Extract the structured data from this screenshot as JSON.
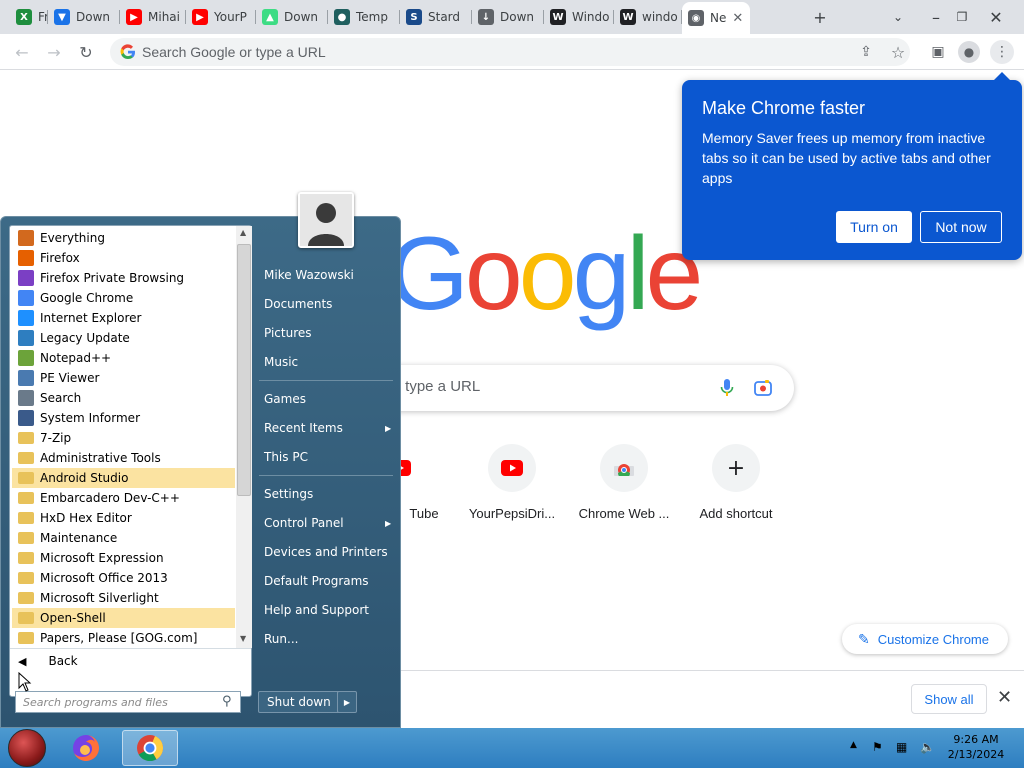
{
  "browser": {
    "tabs": [
      {
        "label": "Free S",
        "fav_color": "#1e8e3e",
        "fav_glyph": "X"
      },
      {
        "label": "Down",
        "fav_color": "#1a73e8",
        "fav_glyph": "▼"
      },
      {
        "label": "Mihai",
        "fav_color": "#ff0000",
        "fav_glyph": "▶"
      },
      {
        "label": "YourP",
        "fav_color": "#ff0000",
        "fav_glyph": "▶"
      },
      {
        "label": "Down",
        "fav_color": "#3ddc84",
        "fav_glyph": "▲"
      },
      {
        "label": "Temp",
        "fav_color": "#1f5f5f",
        "fav_glyph": "●"
      },
      {
        "label": "Stard",
        "fav_color": "#1a4a8a",
        "fav_glyph": "S"
      },
      {
        "label": "Down",
        "fav_color": "#5f6368",
        "fav_glyph": "↓"
      },
      {
        "label": "Windo",
        "fav_color": "#202124",
        "fav_glyph": "W"
      },
      {
        "label": "windo",
        "fav_color": "#202124",
        "fav_glyph": "W"
      },
      {
        "label": "Ne",
        "fav_color": "#5f6368",
        "fav_glyph": "◉"
      }
    ],
    "new_tab_glyph": "+",
    "omnibox_placeholder": "Search Google or type a URL"
  },
  "ntp": {
    "logo_letters": [
      {
        "ch": "G",
        "color": "#4285f4"
      },
      {
        "ch": "o",
        "color": "#ea4335"
      },
      {
        "ch": "o",
        "color": "#fbbc05"
      },
      {
        "ch": "g",
        "color": "#4285f4"
      },
      {
        "ch": "l",
        "color": "#34a853"
      },
      {
        "ch": "e",
        "color": "#ea4335"
      }
    ],
    "search_placeholder": "r type a URL",
    "shortcuts": [
      {
        "label": "Tube"
      },
      {
        "label": "YourPepsiDri..."
      },
      {
        "label": "Chrome Web ..."
      },
      {
        "label": "Add shortcut"
      }
    ],
    "customize_label": "Customize Chrome",
    "show_all_label": "Show all"
  },
  "bubble": {
    "title": "Make Chrome faster",
    "body": "Memory Saver frees up memory from inactive tabs so it can be used by active tabs and other apps",
    "turn_on": "Turn on",
    "not_now": "Not now"
  },
  "startmenu": {
    "programs": [
      {
        "label": "Everything",
        "icon": "magnifier-icon",
        "color": "#d2691e"
      },
      {
        "label": "Firefox",
        "icon": "firefox-icon",
        "color": "#e66000"
      },
      {
        "label": "Firefox Private Browsing",
        "icon": "firefox-private-icon",
        "color": "#7b3fc4"
      },
      {
        "label": "Google Chrome",
        "icon": "chrome-icon",
        "color": "#4285f4"
      },
      {
        "label": "Internet Explorer",
        "icon": "ie-icon",
        "color": "#1e90ff"
      },
      {
        "label": "Legacy Update",
        "icon": "globe-icon",
        "color": "#2e7ec0"
      },
      {
        "label": "Notepad++",
        "icon": "notepad-icon",
        "color": "#6ca33a"
      },
      {
        "label": "PE Viewer",
        "icon": "window-icon",
        "color": "#4a7ab0"
      },
      {
        "label": "Search",
        "icon": "search-icon",
        "color": "#6a7a8a"
      },
      {
        "label": "System Informer",
        "icon": "monitor-icon",
        "color": "#3a5a8a"
      },
      {
        "label": "7-Zip",
        "icon": "folder-icon",
        "color": "#e8c25a"
      },
      {
        "label": "Administrative Tools",
        "icon": "folder-icon",
        "color": "#e8c25a"
      },
      {
        "label": "Android Studio",
        "icon": "folder-icon",
        "color": "#e8c25a",
        "highlight": true
      },
      {
        "label": "Embarcadero Dev-C++",
        "icon": "folder-icon",
        "color": "#e8c25a"
      },
      {
        "label": "HxD Hex Editor",
        "icon": "folder-icon",
        "color": "#e8c25a"
      },
      {
        "label": "Maintenance",
        "icon": "folder-icon",
        "color": "#e8c25a"
      },
      {
        "label": "Microsoft Expression",
        "icon": "folder-icon",
        "color": "#e8c25a"
      },
      {
        "label": "Microsoft Office 2013",
        "icon": "folder-icon",
        "color": "#e8c25a"
      },
      {
        "label": "Microsoft Silverlight",
        "icon": "folder-icon",
        "color": "#e8c25a"
      },
      {
        "label": "Open-Shell",
        "icon": "folder-icon",
        "color": "#e8c25a",
        "highlight": true
      },
      {
        "label": "Papers, Please [GOG.com]",
        "icon": "folder-icon",
        "color": "#e8c25a"
      }
    ],
    "back_label": "Back",
    "search_placeholder": "Search programs and files",
    "right_items": [
      {
        "label": "Mike Wazowski",
        "sub": false
      },
      {
        "label": "Documents",
        "sub": false
      },
      {
        "label": "Pictures",
        "sub": false
      },
      {
        "label": "Music",
        "sub": false
      },
      {
        "label": "Games",
        "sub": false
      },
      {
        "label": "Recent Items",
        "sub": true
      },
      {
        "label": "This PC",
        "sub": false
      },
      {
        "label": "Settings",
        "sub": false
      },
      {
        "label": "Control Panel",
        "sub": true
      },
      {
        "label": "Devices and Printers",
        "sub": false
      },
      {
        "label": "Default Programs",
        "sub": false
      },
      {
        "label": "Help and Support",
        "sub": false
      },
      {
        "label": "Run...",
        "sub": false
      }
    ],
    "shutdown_label": "Shut down"
  },
  "taskbar": {
    "time": "9:26 AM",
    "date": "2/13/2024"
  }
}
